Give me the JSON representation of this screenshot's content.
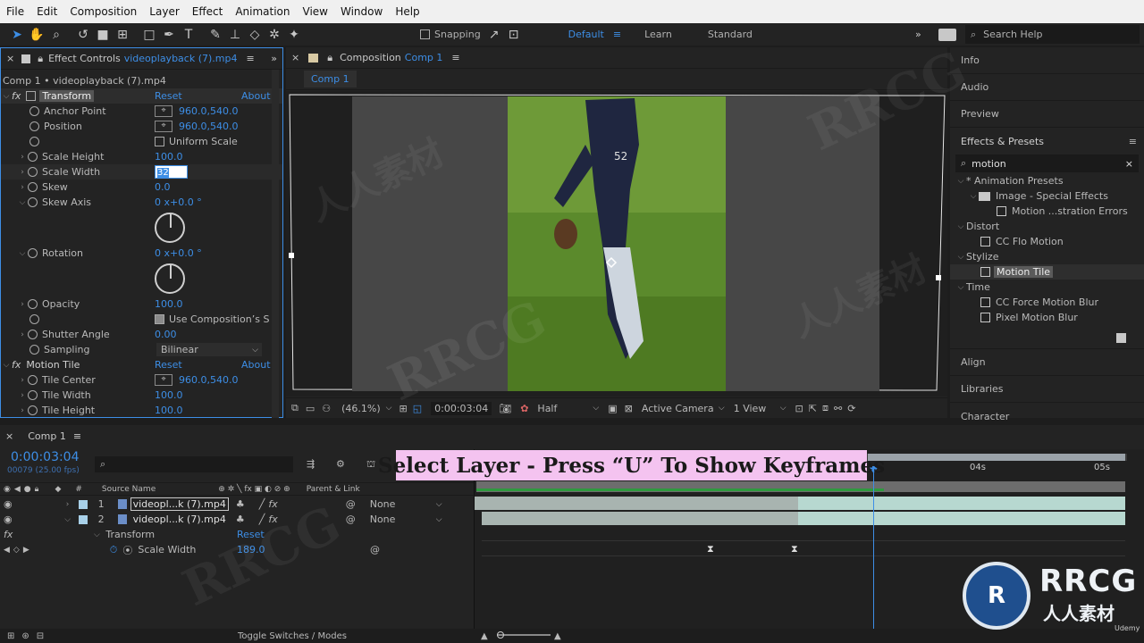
{
  "menu": [
    "File",
    "Edit",
    "Composition",
    "Layer",
    "Effect",
    "Animation",
    "View",
    "Window",
    "Help"
  ],
  "toolbar": {
    "snapping": "Snapping",
    "workspaces": [
      "Default",
      "Learn",
      "Standard"
    ],
    "search_help": "Search Help"
  },
  "effect_controls": {
    "tab_label": "Effect Controls",
    "tab_file": "videoplayback (7).mp4",
    "breadcrumb": "Comp 1 • videoplayback (7).mp4",
    "transform": {
      "name": "Transform",
      "reset": "Reset",
      "about": "About",
      "anchor_point_label": "Anchor Point",
      "anchor_point_value": "960.0,540.0",
      "position_label": "Position",
      "position_value": "960.0,540.0",
      "uniform_scale": "Uniform Scale",
      "scale_height_label": "Scale Height",
      "scale_height_value": "100.0",
      "scale_width_label": "Scale Width",
      "scale_width_value": "32",
      "skew_label": "Skew",
      "skew_value": "0.0",
      "skew_axis_label": "Skew Axis",
      "skew_axis_value": "0 x+0.0 °",
      "rotation_label": "Rotation",
      "rotation_value": "0 x+0.0 °",
      "opacity_label": "Opacity",
      "opacity_value": "100.0",
      "use_comp": "Use Composition’s S",
      "shutter_label": "Shutter Angle",
      "shutter_value": "0.00",
      "sampling_label": "Sampling",
      "sampling_value": "Bilinear"
    },
    "motion_tile": {
      "name": "Motion Tile",
      "reset": "Reset",
      "about": "About",
      "tile_center_label": "Tile Center",
      "tile_center_value": "960.0,540.0",
      "tile_width_label": "Tile Width",
      "tile_width_value": "100.0",
      "tile_height_label": "Tile Height",
      "tile_height_value": "100.0"
    }
  },
  "composition": {
    "tab_label": "Composition",
    "tab_comp": "Comp 1",
    "subtab": "Comp 1",
    "zoom": "(46.1%)",
    "timecode": "0:00:03:04",
    "resolution": "Half",
    "camera": "Active Camera",
    "views": "1 View"
  },
  "right_panels": {
    "top": [
      "Info",
      "Audio",
      "Preview"
    ],
    "effects_presets_title": "Effects & Presets",
    "search_value": "motion",
    "tree": [
      {
        "label": "* Animation Presets",
        "level": 0,
        "type": "group"
      },
      {
        "label": "Image - Special Effects",
        "level": 1,
        "type": "folder"
      },
      {
        "label": "Motion ...stration Errors",
        "level": 2,
        "type": "preset"
      },
      {
        "label": "Distort",
        "level": 0,
        "type": "group"
      },
      {
        "label": "CC Flo Motion",
        "level": 1,
        "type": "effect"
      },
      {
        "label": "Stylize",
        "level": 0,
        "type": "group"
      },
      {
        "label": "Motion Tile",
        "level": 1,
        "type": "effect",
        "selected": true
      },
      {
        "label": "Time",
        "level": 0,
        "type": "group"
      },
      {
        "label": "CC Force Motion Blur",
        "level": 1,
        "type": "effect"
      },
      {
        "label": "Pixel Motion Blur",
        "level": 1,
        "type": "effect"
      }
    ],
    "bottom": [
      "Align",
      "Libraries",
      "Character"
    ]
  },
  "timeline": {
    "tab_label": "Comp 1",
    "timecode": "0:00:03:04",
    "frame_info": "00079 (25.00 fps)",
    "columns": {
      "source_name": "Source Name",
      "parent_link": "Parent & Link"
    },
    "layers": [
      {
        "num": "1",
        "name": "videopl...k (7).mp4",
        "parent": "None"
      },
      {
        "num": "2",
        "name": "videopl...k (7).mp4",
        "parent": "None"
      }
    ],
    "transform_label": "Transform",
    "transform_reset": "Reset",
    "scale_width_label": "Scale Width",
    "scale_width_value": "189.0",
    "ruler": [
      "04s",
      "05s"
    ],
    "footer": "Toggle Switches / Modes"
  },
  "overlay": {
    "caption": "Select Layer - Press “U” To Show Keyframes",
    "watermark": "RRCG",
    "brand_big": "RRCG",
    "brand_small": "人人素材",
    "udemy": "Udemy"
  }
}
